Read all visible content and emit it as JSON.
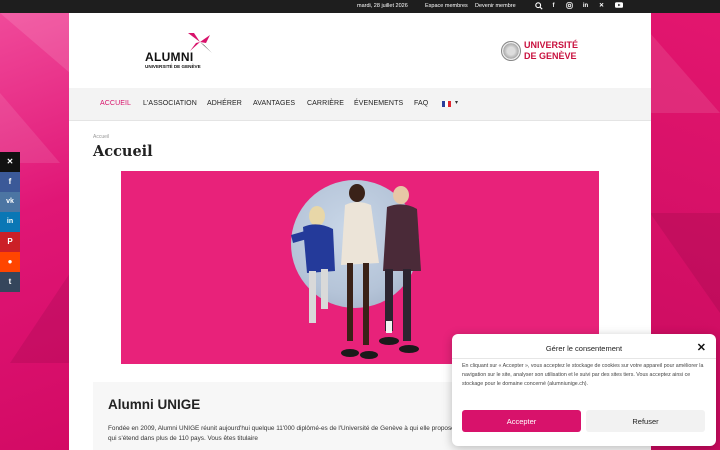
{
  "topbar": {
    "date": "mardi, 28 juillet 2026",
    "links": [
      "Espace membres",
      "Devenir membre"
    ],
    "icons": [
      "search-icon",
      "facebook-icon",
      "instagram-icon",
      "linkedin-icon",
      "x-icon",
      "youtube-icon"
    ]
  },
  "header": {
    "logo_word": "ALUMNI",
    "logo_sub": "UNIVERSITÉ DE GENÈVE",
    "unige_line1": "UNIVERSITÉ",
    "unige_line2": "DE GENÈVE"
  },
  "nav": {
    "items": [
      "ACCUEIL",
      "L'ASSOCIATION",
      "ADHÉRER",
      "AVANTAGES",
      "CARRIÈRE",
      "ÉVENEMENTS",
      "FAQ"
    ],
    "language": "fr"
  },
  "breadcrumb": "Accueil",
  "page_title": "Accueil",
  "intro": {
    "title": "Alumni UNIGE",
    "text": "Fondée en 2009, Alumni UNIGE réunit aujourd'hui quelque 11'000 diplômé-es de l'Université de Genève à qui elle propose un riche programme d'activités et tous les bénéfices d'un réseau qui s'étend dans plus de 110 pays. Vous êtes titulaire"
  },
  "share": [
    "x-icon",
    "facebook-icon",
    "vk-icon",
    "linkedin-icon",
    "pinterest-icon",
    "reddit-icon",
    "tumblr-icon"
  ],
  "cookie": {
    "title": "Gérer le consentement",
    "text": "En cliquant sur « Accepter », vous acceptez le stockage de cookies sur votre appareil pour améliorer la navigation sur le site, analyser son utilisation et le suivi par des sites tiers. Vous acceptez ainsi ce stockage pour le domaine concerné (alumniunige.ch).",
    "accept": "Accepter",
    "refuse": "Refuser"
  },
  "colors": {
    "brand_pink": "#d8126b",
    "topbar": "#1e1e1e"
  }
}
